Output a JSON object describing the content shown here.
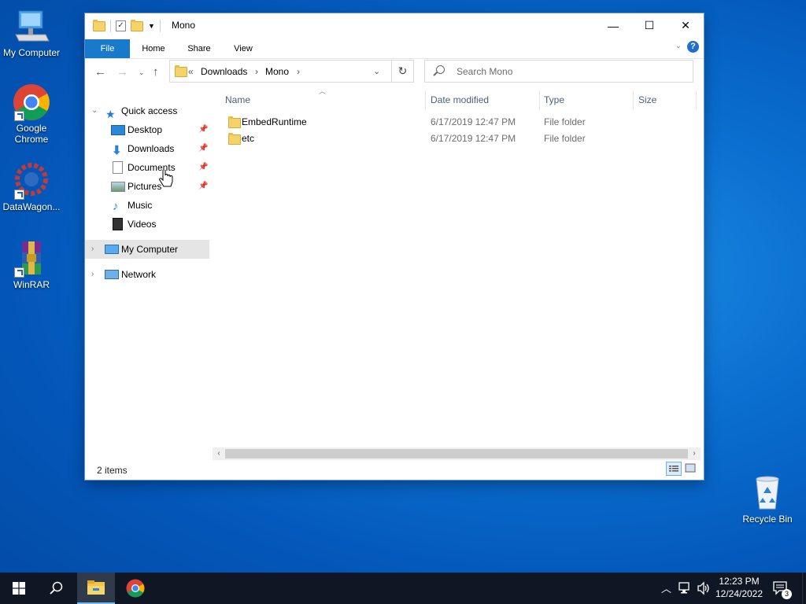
{
  "desktop": {
    "icons": [
      {
        "label": "My Computer"
      },
      {
        "label": "Google Chrome"
      },
      {
        "label": "DataWagon..."
      },
      {
        "label": "WinRAR"
      },
      {
        "label": "Recycle Bin"
      }
    ]
  },
  "window": {
    "title": "Mono",
    "controls": {
      "minimize": "—",
      "maximize": "☐",
      "close": "✕"
    },
    "ribbon_tabs": [
      "File",
      "Home",
      "Share",
      "View"
    ],
    "help": "?",
    "address": {
      "prefix": "«",
      "crumbs": [
        "Downloads",
        "Mono"
      ]
    },
    "search_placeholder": "Search Mono",
    "nav": {
      "quick_access": "Quick access",
      "items": [
        "Desktop",
        "Downloads",
        "Documents",
        "Pictures",
        "Music",
        "Videos"
      ],
      "my_computer": "My Computer",
      "network": "Network"
    },
    "columns": [
      "Name",
      "Date modified",
      "Type",
      "Size"
    ],
    "rows": [
      {
        "name": "EmbedRuntime",
        "date": "6/17/2019 12:47 PM",
        "type": "File folder",
        "size": ""
      },
      {
        "name": "etc",
        "date": "6/17/2019 12:47 PM",
        "type": "File folder",
        "size": ""
      }
    ],
    "status": "2 items"
  },
  "taskbar": {
    "time": "12:23 PM",
    "date": "12/24/2022",
    "notification_count": "3"
  },
  "colors": {
    "accent": "#1979ca",
    "taskbar": "#0f1724",
    "folder": "#f5d36b"
  }
}
